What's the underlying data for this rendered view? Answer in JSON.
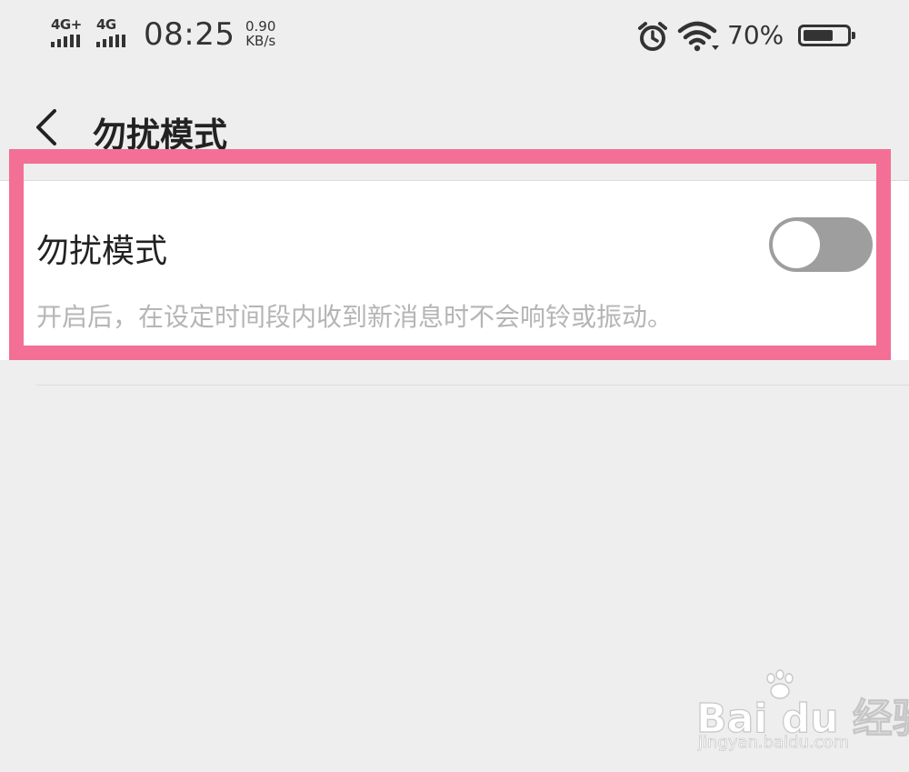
{
  "status_bar": {
    "sim1_label": "4G+",
    "sim2_label": "4G",
    "time": "08:25",
    "net_speed_value": "0.90",
    "net_speed_unit": "KB/s",
    "battery_percent": "70%",
    "battery_level": 0.7,
    "icons": [
      "signal-bars-icon",
      "alarm-clock-icon",
      "wifi-icon",
      "battery-icon"
    ]
  },
  "header": {
    "back_icon": "chevron-left-icon",
    "title": "勿扰模式"
  },
  "setting": {
    "title": "勿扰模式",
    "description": "开启后，在设定时间段内收到新消息时不会响铃或振动。",
    "enabled": false
  },
  "watermark": {
    "text": "Bai du 经验",
    "url": "jingyan.baidu.com"
  },
  "colors": {
    "background": "#eeeeee",
    "card": "#ffffff",
    "highlight": "#f36f95",
    "toggle_off": "#9e9e9e",
    "description": "#b5b5b5"
  }
}
